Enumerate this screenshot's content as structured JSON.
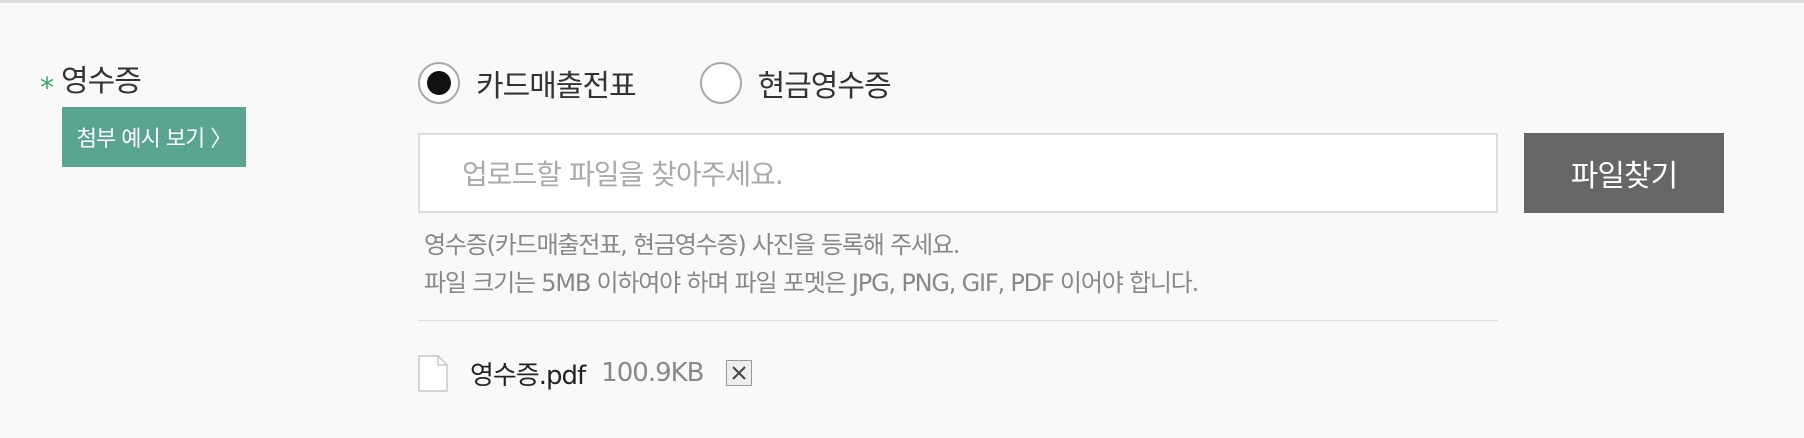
{
  "field": {
    "required_mark": "*",
    "label": "영수증",
    "example_button": "첨부 예시 보기",
    "example_chevron": "〉"
  },
  "receipt_type": {
    "options": [
      {
        "label": "카드매출전표",
        "selected": true
      },
      {
        "label": "현금영수증",
        "selected": false
      }
    ]
  },
  "upload": {
    "placeholder": "업로드할 파일을 찾아주세요.",
    "find_button": "파일찾기",
    "help_lines": [
      "영수증(카드매출전표, 현금영수증) 사진을 등록해 주세요.",
      "파일 크기는 5MB 이하여야 하며 파일 포멧은 JPG, PNG, GIF, PDF 이어야 합니다."
    ]
  },
  "attached_file": {
    "icon": "document-icon",
    "name": "영수증.pdf",
    "size": "100.9KB",
    "remove_icon": "close-icon"
  },
  "colors": {
    "required_star": "#3aa468",
    "example_button_bg": "#5aa592",
    "find_button_bg": "#666666"
  }
}
